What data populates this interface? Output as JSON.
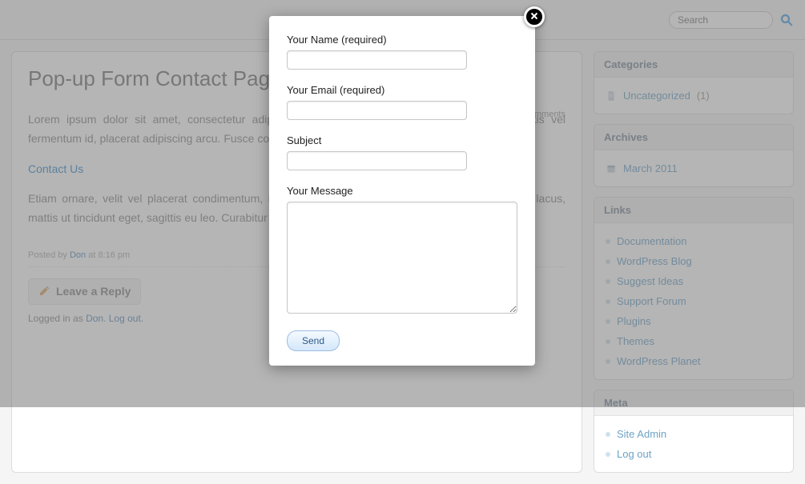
{
  "header": {
    "search_placeholder": "Search"
  },
  "post": {
    "title": "Pop-up Form Contact Page",
    "meta_suffix": "mments",
    "para1": "Lorem ipsum dolor sit amet, consectetur adipiscing elit. Vivamus ornare tristique augue, lobortis vel fermentum id, placerat adipiscing arcu. Fusce consectetur ultricies vel quam.",
    "contact_link": "Contact Us",
    "para2": "Etiam ornare, velit vel placerat condimentum, mauris eros sollicitudin lacus non sagna. Ut lectus lacus, mattis ut tincidunt eget, sagittis eu leo. Curabitur a quam vitae elit lacus blandit nec.",
    "posted_prefix": "Posted by ",
    "posted_author": "Don",
    "posted_suffix": " at 8:16 pm",
    "leave_reply": "Leave a Reply",
    "logged_prefix": "Logged in as ",
    "logged_user": "Don",
    "logged_sep": ". ",
    "logout": "Log out",
    "logged_end": "."
  },
  "sidebar": {
    "categories": {
      "title": "Categories",
      "item": "Uncategorized",
      "count": "(1)"
    },
    "archives": {
      "title": "Archives",
      "item": "March 2011"
    },
    "links": {
      "title": "Links",
      "items": [
        "Documentation",
        "WordPress Blog",
        "Suggest Ideas",
        "Support Forum",
        "Plugins",
        "Themes",
        "WordPress Planet"
      ]
    },
    "meta": {
      "title": "Meta",
      "items": [
        "Site Admin",
        "Log out"
      ]
    }
  },
  "modal": {
    "name_label": "Your Name (required)",
    "email_label": "Your Email (required)",
    "subject_label": "Subject",
    "message_label": "Your Message",
    "send": "Send"
  }
}
